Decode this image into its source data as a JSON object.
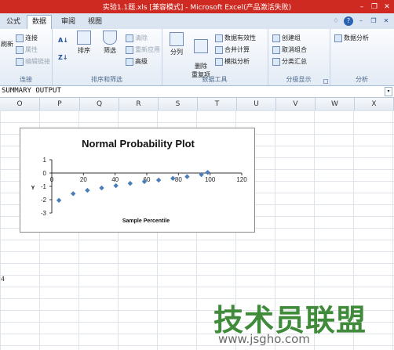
{
  "window": {
    "title": "实验1.1题.xls  [兼容模式]  - Microsoft Excel(产品激活失败)",
    "controls": [
      "–",
      "❐",
      "✕"
    ]
  },
  "tabs": [
    "公式",
    "数据",
    "审阅",
    "视图"
  ],
  "active_tab": "数据",
  "help_icons": [
    "♢",
    "?",
    "–",
    "❐",
    "✕"
  ],
  "ribbon": {
    "connections": {
      "label": "连接",
      "items": [
        "连接",
        "属性",
        "编辑链接"
      ],
      "refresh": "刷新"
    },
    "sort_filter": {
      "label": "排序和筛选",
      "sort": "排序",
      "filter": "筛选",
      "clear": "清除",
      "reapply": "重新应用",
      "advanced": "高级"
    },
    "data_tools": {
      "label": "数据工具",
      "split": "分列",
      "remove_dup": "删除\n重复项",
      "validation": "数据有效性",
      "consolidate": "合并计算",
      "whatif": "模拟分析"
    },
    "outline": {
      "label": "分级显示",
      "group": "创建组",
      "ungroup": "取消组合",
      "subtotal": "分类汇总"
    },
    "analysis": {
      "label": "分析",
      "data_analysis": "数据分析"
    }
  },
  "formula_bar": {
    "value": "SUMMARY OUTPUT"
  },
  "columns": [
    "O",
    "P",
    "Q",
    "R",
    "S",
    "T",
    "U",
    "V",
    "W",
    "X"
  ],
  "row_fragment": "4",
  "chart_data": {
    "type": "scatter",
    "title": "Normal Probability Plot",
    "xlabel": "Sample Percentile",
    "ylabel": "Y",
    "xlim": [
      0,
      120
    ],
    "ylim": [
      -3,
      1
    ],
    "xticks": [
      0,
      20,
      40,
      60,
      80,
      100,
      120
    ],
    "yticks": [
      1,
      0,
      -1,
      -2,
      -3
    ],
    "points": [
      {
        "x": 4.5,
        "y": -2.05
      },
      {
        "x": 13.5,
        "y": -1.55
      },
      {
        "x": 22.5,
        "y": -1.3
      },
      {
        "x": 31.5,
        "y": -1.12
      },
      {
        "x": 40.5,
        "y": -0.95
      },
      {
        "x": 49.5,
        "y": -0.78
      },
      {
        "x": 58.5,
        "y": -0.64
      },
      {
        "x": 67.5,
        "y": -0.53
      },
      {
        "x": 76.5,
        "y": -0.4
      },
      {
        "x": 85.5,
        "y": -0.27
      },
      {
        "x": 94.5,
        "y": -0.12
      },
      {
        "x": 98.5,
        "y": 0.05
      }
    ],
    "marker_color": "#4a7ebb"
  },
  "watermark": {
    "text": "技术员联盟",
    "url": "www.jsgho.com"
  }
}
